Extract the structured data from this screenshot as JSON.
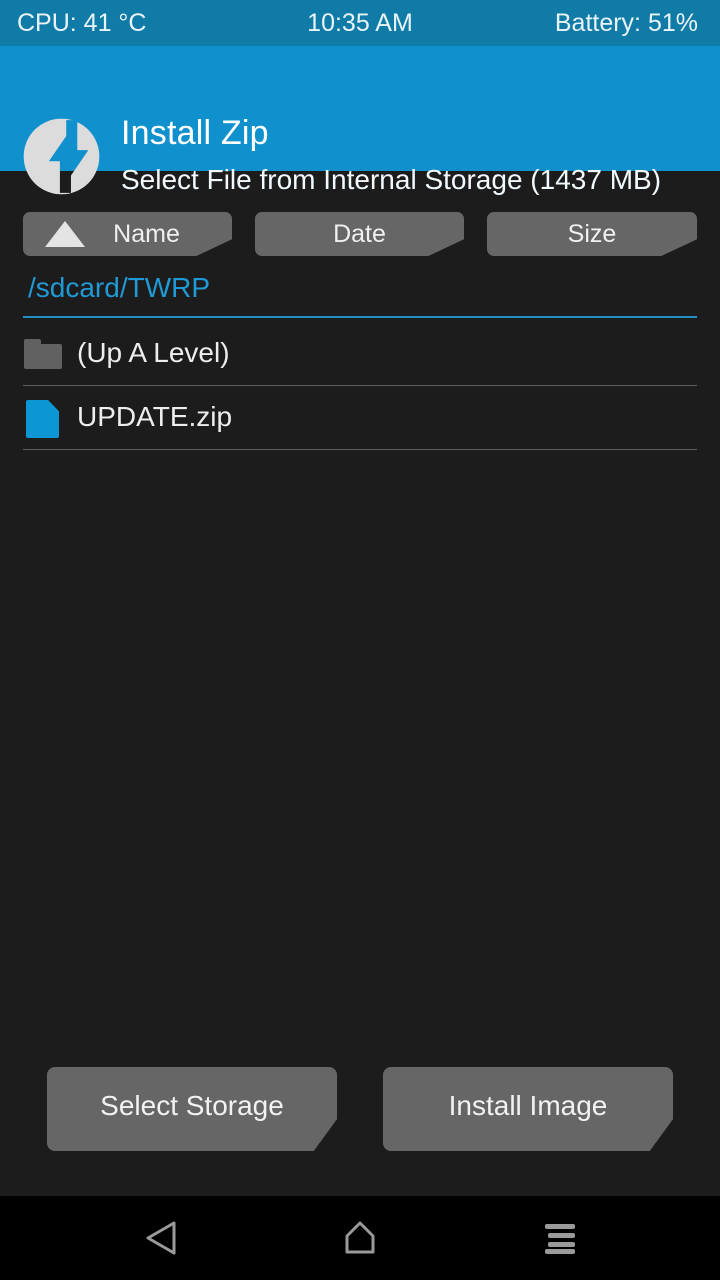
{
  "status_bar": {
    "cpu": "CPU: 41 °C",
    "time": "10:35 AM",
    "battery": "Battery: 51%",
    "background_color": "#0f7ba6"
  },
  "header": {
    "title": "Install Zip",
    "subtitle": "Select File from Internal Storage (1437 MB)",
    "logo_icon": "twrp-logo-icon",
    "background_color": "#1091ce"
  },
  "sort_bar": {
    "buttons": [
      {
        "label": "Name",
        "icon": "sort-ascending-triangle-icon",
        "active": true
      },
      {
        "label": "Date",
        "icon": "",
        "active": false
      },
      {
        "label": "Size",
        "icon": "",
        "active": false
      }
    ]
  },
  "path": {
    "current": "/sdcard/TWRP",
    "color": "#1f9ad6"
  },
  "file_list": {
    "items": [
      {
        "name": "(Up A Level)",
        "icon": "folder-icon",
        "type": "folder"
      },
      {
        "name": "UPDATE.zip",
        "icon": "zip-file-icon",
        "type": "file"
      }
    ]
  },
  "action_bar": {
    "buttons": [
      {
        "label": "Select Storage"
      },
      {
        "label": "Install Image"
      }
    ]
  },
  "nav_bar": {
    "buttons": [
      {
        "icon": "back-triangle-icon",
        "label": "Back"
      },
      {
        "icon": "home-icon",
        "label": "Home"
      },
      {
        "icon": "recents-menu-icon",
        "label": "Recents"
      }
    ]
  },
  "theme": {
    "background": "#1c1c1c",
    "accent_blue": "#1091ce",
    "button_gray": "#666666",
    "divider": "#5e5e5e"
  }
}
